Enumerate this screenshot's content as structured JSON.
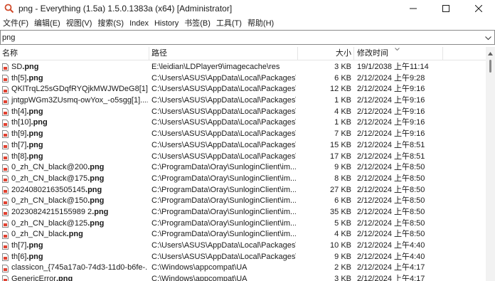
{
  "window": {
    "title": "png - Everything (1.5a) 1.5.0.1383a (x64) [Administrator]"
  },
  "menu": [
    "文件(F)",
    "编辑(E)",
    "视图(V)",
    "搜索(S)",
    "Index",
    "History",
    "书签(B)",
    "工具(T)",
    "帮助(H)"
  ],
  "search": {
    "value": "png"
  },
  "columns": {
    "name": "名称",
    "path": "路径",
    "size": "大小",
    "modified": "修改时间"
  },
  "rows": [
    {
      "base": "SD",
      "ext": ".png",
      "path": "E:\\leidian\\LDPlayer9\\imagecache\\res",
      "size": "3 KB",
      "date": "19/1/2038 上午11:14"
    },
    {
      "base": "th[5]",
      "ext": ".png",
      "path": "C:\\Users\\ASUS\\AppData\\Local\\Packages\\...",
      "size": "6 KB",
      "date": "2/12/2024 上午9:28"
    },
    {
      "base": "QKlTrqL25sGDqfRYQjkMWJWDeG8[1]....",
      "ext": "",
      "path": "C:\\Users\\ASUS\\AppData\\Local\\Packages\\...",
      "size": "12 KB",
      "date": "2/12/2024 上午9:16"
    },
    {
      "base": "jntgpWGm3ZUsmq-owYox_-o5sgg[1]....",
      "ext": "",
      "path": "C:\\Users\\ASUS\\AppData\\Local\\Packages\\...",
      "size": "1 KB",
      "date": "2/12/2024 上午9:16"
    },
    {
      "base": "th[4]",
      "ext": ".png",
      "path": "C:\\Users\\ASUS\\AppData\\Local\\Packages\\...",
      "size": "4 KB",
      "date": "2/12/2024 上午9:16"
    },
    {
      "base": "th[10]",
      "ext": ".png",
      "path": "C:\\Users\\ASUS\\AppData\\Local\\Packages\\...",
      "size": "1 KB",
      "date": "2/12/2024 上午9:16"
    },
    {
      "base": "th[9]",
      "ext": ".png",
      "path": "C:\\Users\\ASUS\\AppData\\Local\\Packages\\...",
      "size": "7 KB",
      "date": "2/12/2024 上午9:16"
    },
    {
      "base": "th[7]",
      "ext": ".png",
      "path": "C:\\Users\\ASUS\\AppData\\Local\\Packages\\...",
      "size": "15 KB",
      "date": "2/12/2024 上午8:51"
    },
    {
      "base": "th[8]",
      "ext": ".png",
      "path": "C:\\Users\\ASUS\\AppData\\Local\\Packages\\...",
      "size": "17 KB",
      "date": "2/12/2024 上午8:51"
    },
    {
      "base": "0_zh_CN_black@200",
      "ext": ".png",
      "path": "C:\\ProgramData\\Oray\\SunloginClient\\im...",
      "size": "9 KB",
      "date": "2/12/2024 上午8:50"
    },
    {
      "base": "0_zh_CN_black@175",
      "ext": ".png",
      "path": "C:\\ProgramData\\Oray\\SunloginClient\\im...",
      "size": "8 KB",
      "date": "2/12/2024 上午8:50"
    },
    {
      "base": "20240802163505145",
      "ext": ".png",
      "path": "C:\\ProgramData\\Oray\\SunloginClient\\im...",
      "size": "27 KB",
      "date": "2/12/2024 上午8:50"
    },
    {
      "base": "0_zh_CN_black@150",
      "ext": ".png",
      "path": "C:\\ProgramData\\Oray\\SunloginClient\\im...",
      "size": "6 KB",
      "date": "2/12/2024 上午8:50"
    },
    {
      "base": "20230824215155989 2",
      "ext": ".png",
      "path": "C:\\ProgramData\\Oray\\SunloginClient\\im...",
      "size": "35 KB",
      "date": "2/12/2024 上午8:50"
    },
    {
      "base": "0_zh_CN_black@125",
      "ext": ".png",
      "path": "C:\\ProgramData\\Oray\\SunloginClient\\im...",
      "size": "5 KB",
      "date": "2/12/2024 上午8:50"
    },
    {
      "base": "0_zh_CN_black",
      "ext": ".png",
      "path": "C:\\ProgramData\\Oray\\SunloginClient\\im...",
      "size": "4 KB",
      "date": "2/12/2024 上午8:50"
    },
    {
      "base": "th[7]",
      "ext": ".png",
      "path": "C:\\Users\\ASUS\\AppData\\Local\\Packages\\...",
      "size": "10 KB",
      "date": "2/12/2024 上午4:40"
    },
    {
      "base": "th[6]",
      "ext": ".png",
      "path": "C:\\Users\\ASUS\\AppData\\Local\\Packages\\...",
      "size": "9 KB",
      "date": "2/12/2024 上午4:40"
    },
    {
      "base": "classicon_{745a17a0-74d3-11d0-b6fe-...",
      "ext": "",
      "path": "C:\\Windows\\appcompat\\UA",
      "size": "2 KB",
      "date": "2/12/2024 上午4:17"
    },
    {
      "base": "GenericError",
      "ext": ".png",
      "path": "C:\\Windows\\appcompat\\UA",
      "size": "3 KB",
      "date": "2/12/2024 上午4:17"
    }
  ]
}
